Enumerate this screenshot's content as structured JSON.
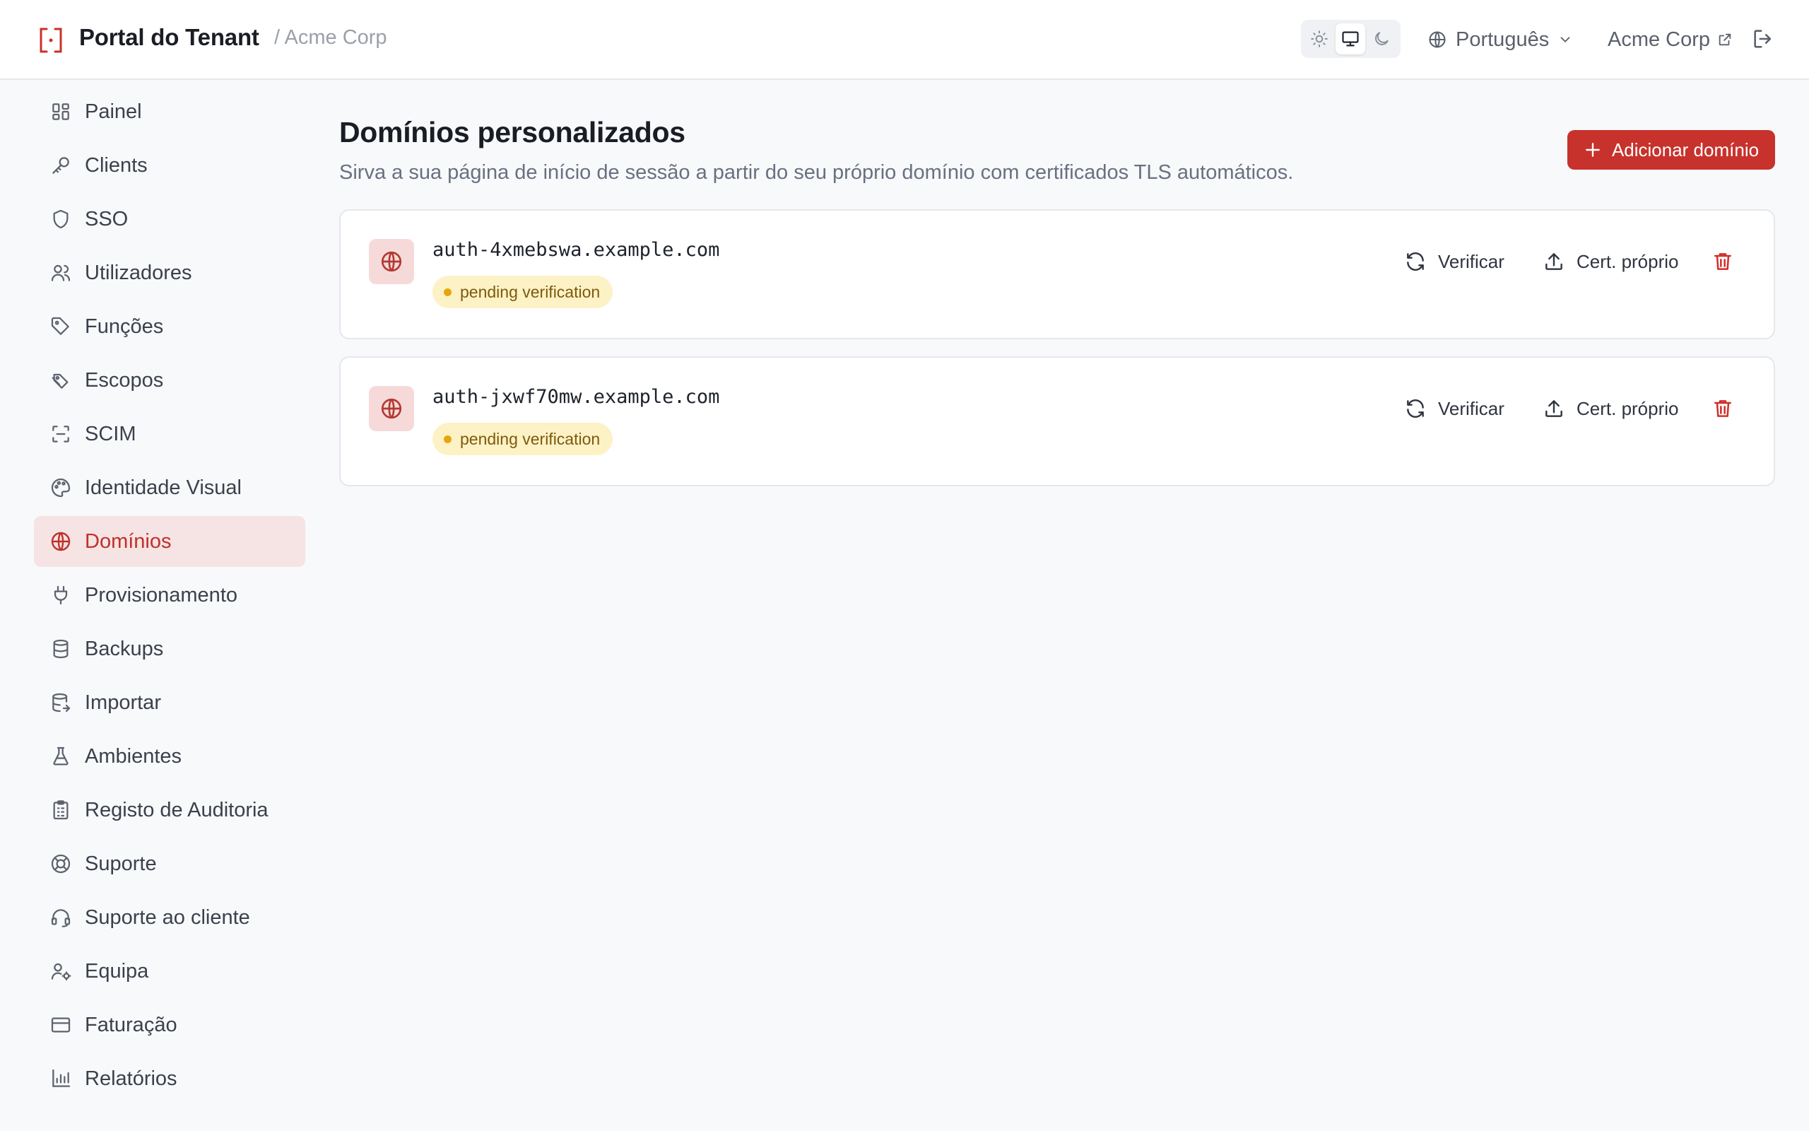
{
  "header": {
    "title": "Portal do Tenant",
    "breadcrumb": "/ Acme Corp",
    "theme_modes": [
      "light",
      "system",
      "dark"
    ],
    "active_theme": "system",
    "language": "Português",
    "tenant_name": "Acme Corp"
  },
  "sidebar": {
    "items": [
      {
        "label": "Painel",
        "icon": "dashboard-icon"
      },
      {
        "label": "Clients",
        "icon": "key-icon"
      },
      {
        "label": "SSO",
        "icon": "shield-icon"
      },
      {
        "label": "Utilizadores",
        "icon": "users-icon"
      },
      {
        "label": "Funções",
        "icon": "tag-icon"
      },
      {
        "label": "Escopos",
        "icon": "tags-icon"
      },
      {
        "label": "SCIM",
        "icon": "scan-icon"
      },
      {
        "label": "Identidade Visual",
        "icon": "palette-icon"
      },
      {
        "label": "Domínios",
        "icon": "globe-icon",
        "active": true
      },
      {
        "label": "Provisionamento",
        "icon": "plug-icon"
      },
      {
        "label": "Backups",
        "icon": "database-icon"
      },
      {
        "label": "Importar",
        "icon": "database-import-icon"
      },
      {
        "label": "Ambientes",
        "icon": "flask-icon"
      },
      {
        "label": "Registo de Auditoria",
        "icon": "clipboard-icon"
      },
      {
        "label": "Suporte",
        "icon": "lifebuoy-icon"
      },
      {
        "label": "Suporte ao cliente",
        "icon": "headset-icon"
      },
      {
        "label": "Equipa",
        "icon": "user-cog-icon"
      },
      {
        "label": "Faturação",
        "icon": "credit-card-icon"
      },
      {
        "label": "Relatórios",
        "icon": "bar-chart-icon"
      }
    ]
  },
  "main": {
    "title": "Domínios personalizados",
    "subtitle": "Sirva a sua página de início de sessão a partir do seu próprio domínio com certificados TLS automáticos.",
    "add_button": "Adicionar domínio",
    "domains": [
      {
        "host": "auth-4xmebswa.example.com",
        "status": "pending verification"
      },
      {
        "host": "auth-jxwf70mw.example.com",
        "status": "pending verification"
      }
    ],
    "actions": {
      "verify": "Verificar",
      "own_cert": "Cert. próprio"
    }
  },
  "colors": {
    "accent": "#c8322c",
    "active_nav_bg": "#f6e3e3",
    "pending_badge_bg": "#fdf2c6",
    "pending_dot": "#e8a50d"
  }
}
